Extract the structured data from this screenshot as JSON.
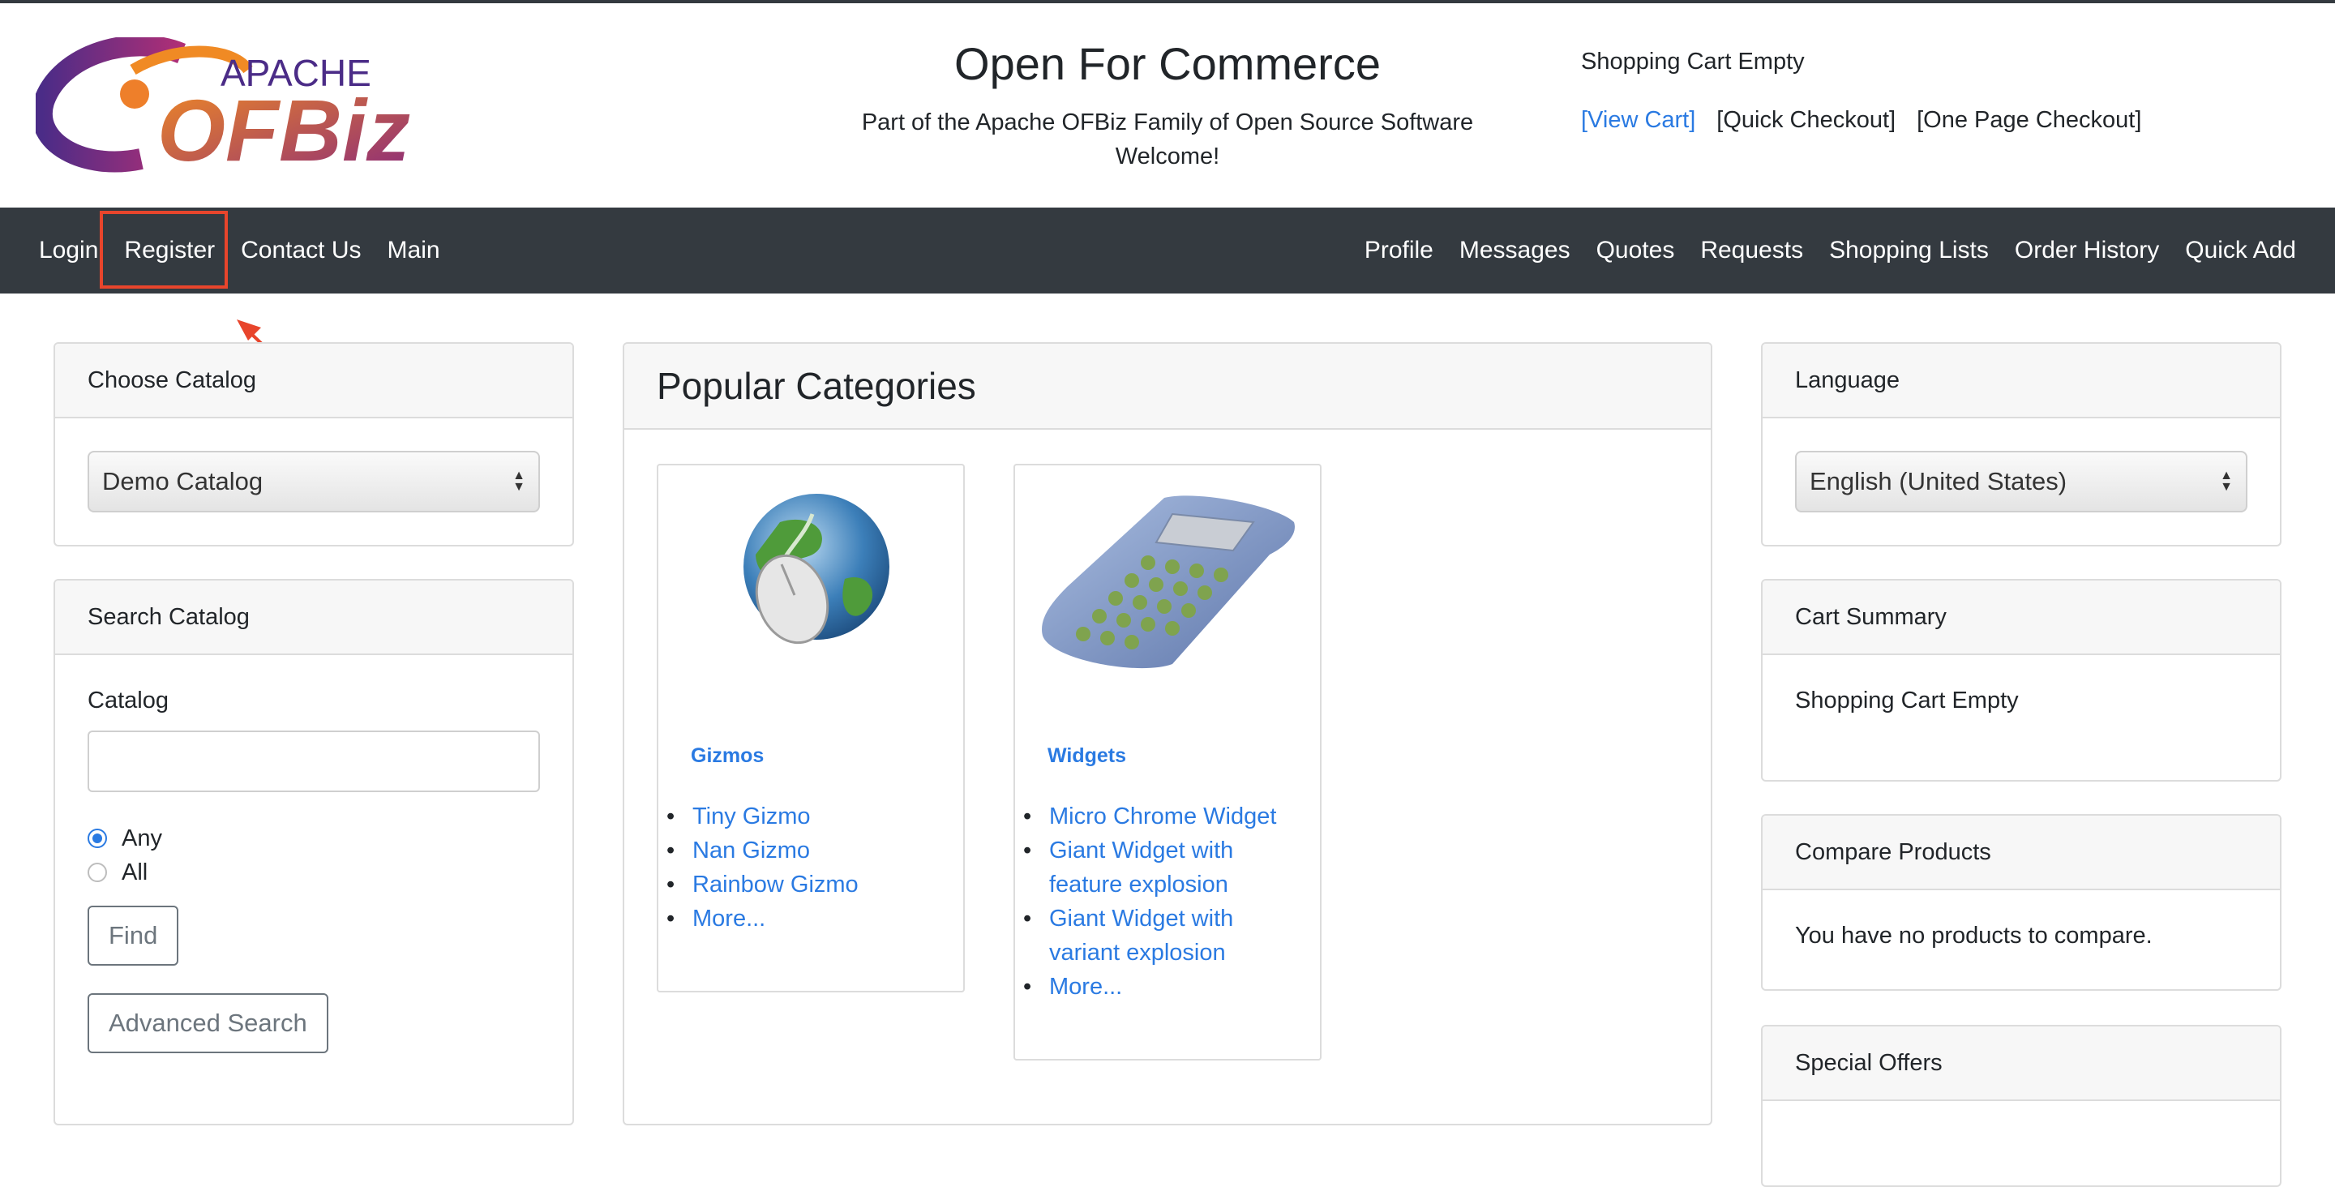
{
  "header": {
    "logo_text_top": "APACHE",
    "logo_text_main": "OFBiz",
    "title": "Open For Commerce",
    "subtitle": "Part of the Apache OFBiz Family of Open Source Software",
    "welcome": "Welcome!",
    "cart_status": "Shopping Cart Empty",
    "cart_links": [
      "[View Cart]",
      "[Quick Checkout]",
      "[One Page Checkout]"
    ]
  },
  "nav": {
    "left": [
      "Login",
      "Register",
      "Contact Us",
      "Main"
    ],
    "right": [
      "Profile",
      "Messages",
      "Quotes",
      "Requests",
      "Shopping Lists",
      "Order History",
      "Quick Add"
    ]
  },
  "choose_catalog": {
    "title": "Choose Catalog",
    "selected": "Demo Catalog"
  },
  "search_catalog": {
    "title": "Search Catalog",
    "field_label": "Catalog",
    "input_value": "",
    "options": [
      "Any",
      "All"
    ],
    "selected_option": "Any",
    "find_label": "Find",
    "advanced_label": "Advanced Search"
  },
  "popular": {
    "title": "Popular Categories",
    "categories": [
      {
        "name": "Gizmos",
        "icon": "globe-mouse-icon",
        "items": [
          "Tiny Gizmo",
          "Nan Gizmo",
          "Rainbow Gizmo",
          "More..."
        ]
      },
      {
        "name": "Widgets",
        "icon": "calculator-icon",
        "items": [
          "Micro Chrome Widget",
          "Giant Widget with",
          "feature explosion",
          "Giant Widget with",
          "variant explosion",
          "More..."
        ]
      }
    ]
  },
  "language": {
    "title": "Language",
    "selected": "English (United States)"
  },
  "cart_summary": {
    "title": "Cart Summary",
    "text": "Shopping Cart Empty"
  },
  "compare": {
    "title": "Compare Products",
    "text": "You have no products to compare."
  },
  "special_offers": {
    "title": "Special Offers"
  },
  "annotation": {
    "highlight_color": "#e8452c"
  },
  "colors": {
    "navbar": "#343a40",
    "link": "#2a7ae2"
  }
}
